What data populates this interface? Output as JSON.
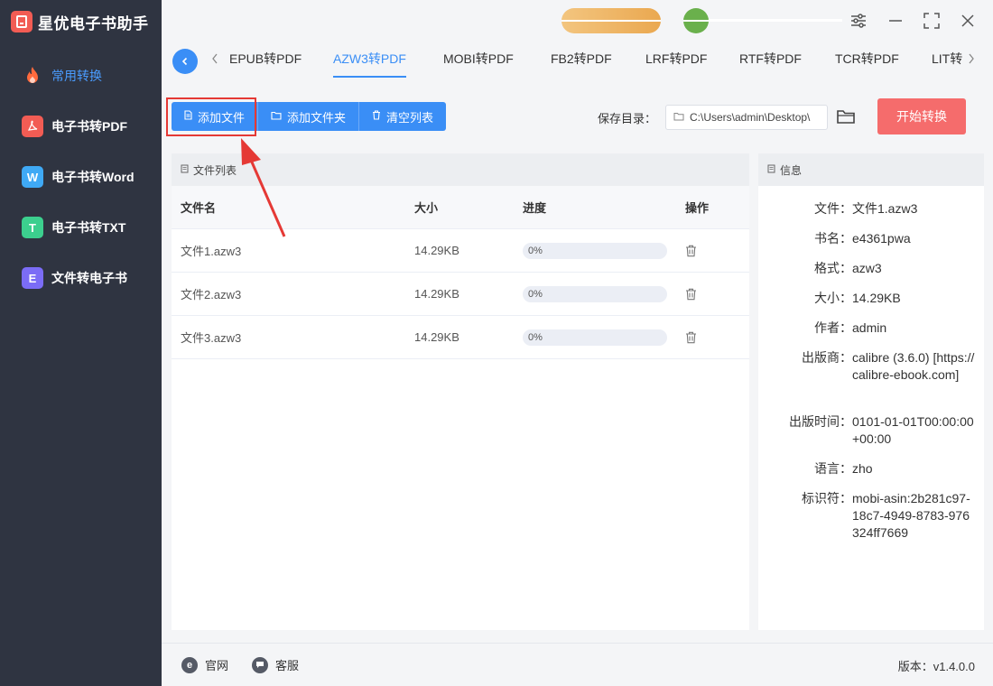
{
  "app": {
    "title": "星优电子书助手"
  },
  "sidebar": {
    "items": [
      {
        "label": "常用转换",
        "icon": "flame-icon",
        "color": "#ff6a3d",
        "letter": ""
      },
      {
        "label": "电子书转PDF",
        "icon": "pdf-icon",
        "color": "#f25c54",
        "letter": ""
      },
      {
        "label": "电子书转Word",
        "icon": "word-icon",
        "color": "#3fa9f5",
        "letter": "W"
      },
      {
        "label": "电子书转TXT",
        "icon": "txt-icon",
        "color": "#3ccf8e",
        "letter": "T"
      },
      {
        "label": "文件转电子书",
        "icon": "ebook-icon",
        "color": "#7b6cf6",
        "letter": "E"
      }
    ]
  },
  "tabs": [
    {
      "label": "EPUB转PDF"
    },
    {
      "label": "AZW3转PDF",
      "active": true
    },
    {
      "label": "MOBI转PDF"
    },
    {
      "label": "FB2转PDF"
    },
    {
      "label": "LRF转PDF"
    },
    {
      "label": "RTF转PDF"
    },
    {
      "label": "TCR转PDF"
    },
    {
      "label": "LIT转"
    }
  ],
  "actions": {
    "add_file": "添加文件",
    "add_folder": "添加文件夹",
    "clear_list": "清空列表"
  },
  "save": {
    "label": "保存目录：",
    "path": "C:\\Users\\admin\\Desktop\\"
  },
  "start_button": "开始转换",
  "file_panel": {
    "title": "文件列表",
    "columns": {
      "name": "文件名",
      "size": "大小",
      "progress": "进度",
      "action": "操作"
    },
    "rows": [
      {
        "name": "文件1.azw3",
        "size": "14.29KB",
        "progress": "0%",
        "progress_value": 0
      },
      {
        "name": "文件2.azw3",
        "size": "14.29KB",
        "progress": "0%",
        "progress_value": 0
      },
      {
        "name": "文件3.azw3",
        "size": "14.29KB",
        "progress": "0%",
        "progress_value": 0
      }
    ]
  },
  "info_panel": {
    "title": "信息",
    "rows": [
      {
        "key": "文件：",
        "value": "文件1.azw3"
      },
      {
        "key": "书名：",
        "value": "e4361pwa"
      },
      {
        "key": "格式：",
        "value": "azw3"
      },
      {
        "key": "大小：",
        "value": "14.29KB"
      },
      {
        "key": "作者：",
        "value": "admin"
      },
      {
        "key": "出版商：",
        "value": "calibre (3.6.0) [https://calibre-ebook.com]"
      },
      {
        "key": "出版时间：",
        "value": "0101-01-01T00:00:00+00:00"
      },
      {
        "key": "语言：",
        "value": "zho"
      },
      {
        "key": "标识符：",
        "value": "mobi-asin:2b281c97-18c7-4949-8783-976324ff7669"
      }
    ]
  },
  "footer": {
    "website": "官网",
    "support": "客服",
    "version": "版本：v1.4.0.0"
  },
  "colors": {
    "accent": "#3a8ef6",
    "start": "#f56c6c",
    "sidebar_bg": "#2f3441",
    "highlight": "#e53935"
  }
}
